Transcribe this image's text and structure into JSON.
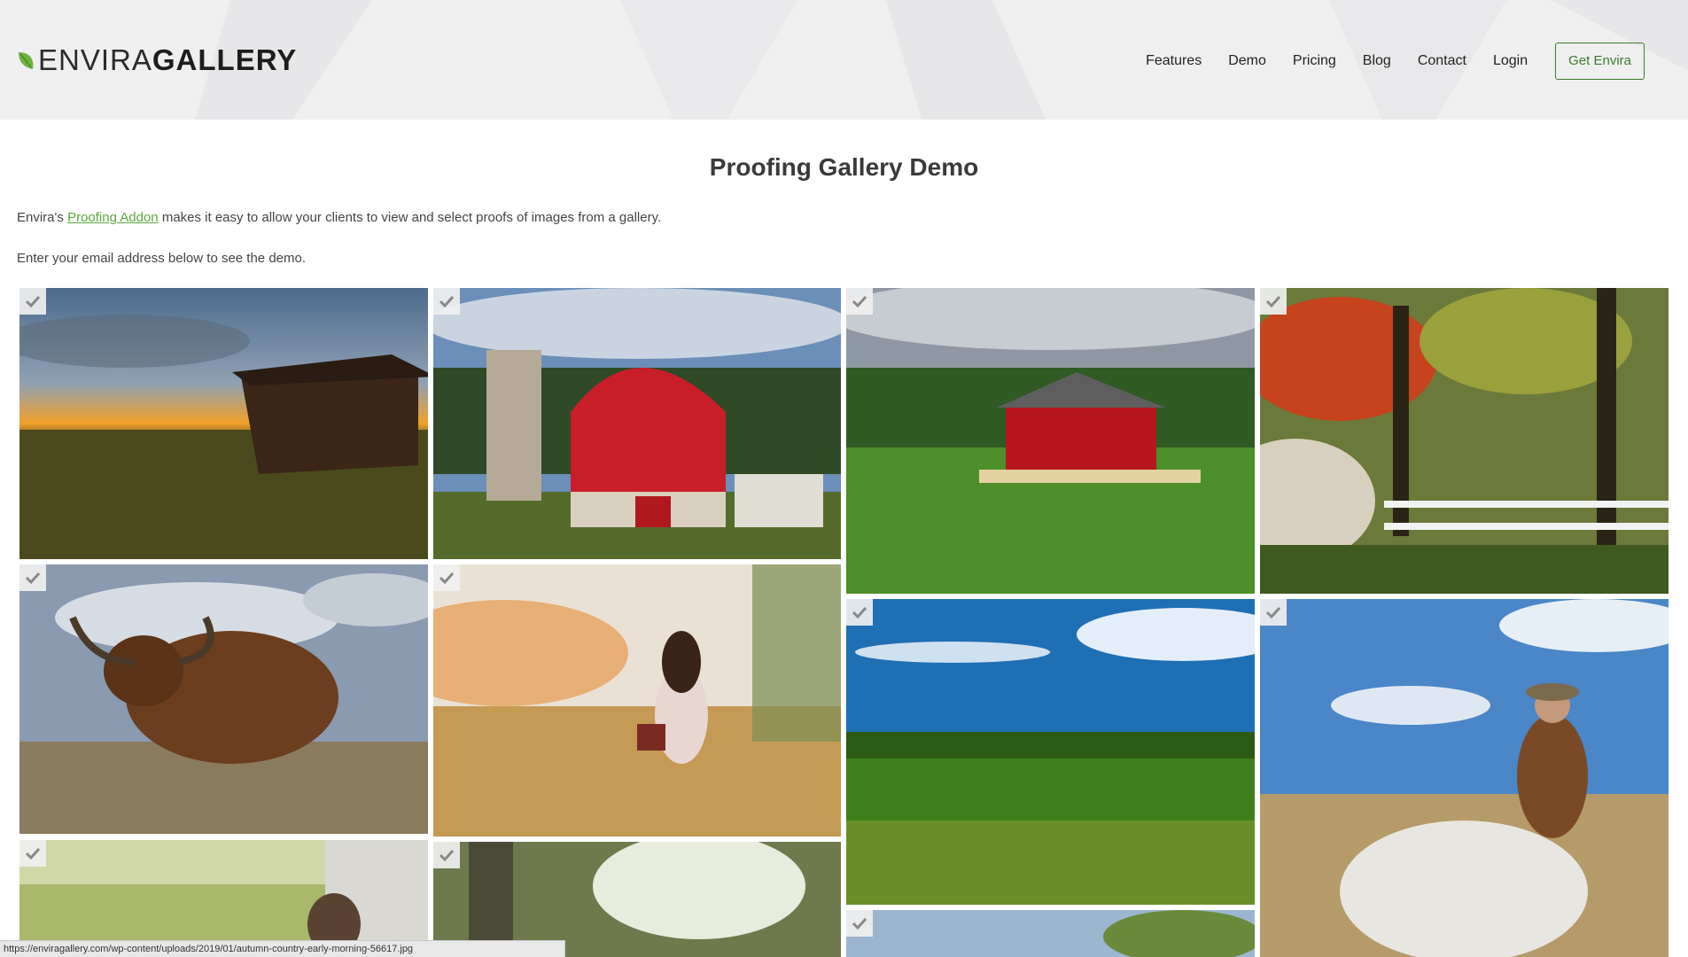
{
  "header": {
    "logo_light": "ENVIRA",
    "logo_bold": "GALLERY",
    "nav": [
      {
        "label": "Features"
      },
      {
        "label": "Demo"
      },
      {
        "label": "Pricing"
      },
      {
        "label": "Blog"
      },
      {
        "label": "Contact"
      },
      {
        "label": "Login"
      }
    ],
    "cta_label": "Get Envira"
  },
  "main": {
    "title": "Proofing Gallery Demo",
    "intro_prefix": "Envira's ",
    "intro_link": "Proofing Addon",
    "intro_suffix": " makes it easy to allow your clients to view and select proofs of images from a gallery.",
    "instruction": "Enter your email address below to see the demo."
  },
  "gallery": {
    "items": [
      {
        "subject": "shed at sunset"
      },
      {
        "subject": "red barn and silo"
      },
      {
        "subject": "red barn on green hill"
      },
      {
        "subject": "autumn forest with white fence"
      },
      {
        "subject": "highland cow"
      },
      {
        "subject": "girl with basket in field"
      },
      {
        "subject": "green fields under blue sky"
      },
      {
        "subject": "cowboy on white horse"
      },
      {
        "subject": "bear cub in grass"
      },
      {
        "subject": "tree with bokeh"
      },
      {
        "subject": "blue sky with plants"
      }
    ]
  },
  "statusbar": {
    "url": "https://enviragallery.com/wp-content/uploads/2019/01/autumn-country-early-morning-56617.jpg"
  },
  "colors": {
    "accent": "#3c7a2a",
    "link": "#5aa83a",
    "header_bg": "#efeff0"
  }
}
